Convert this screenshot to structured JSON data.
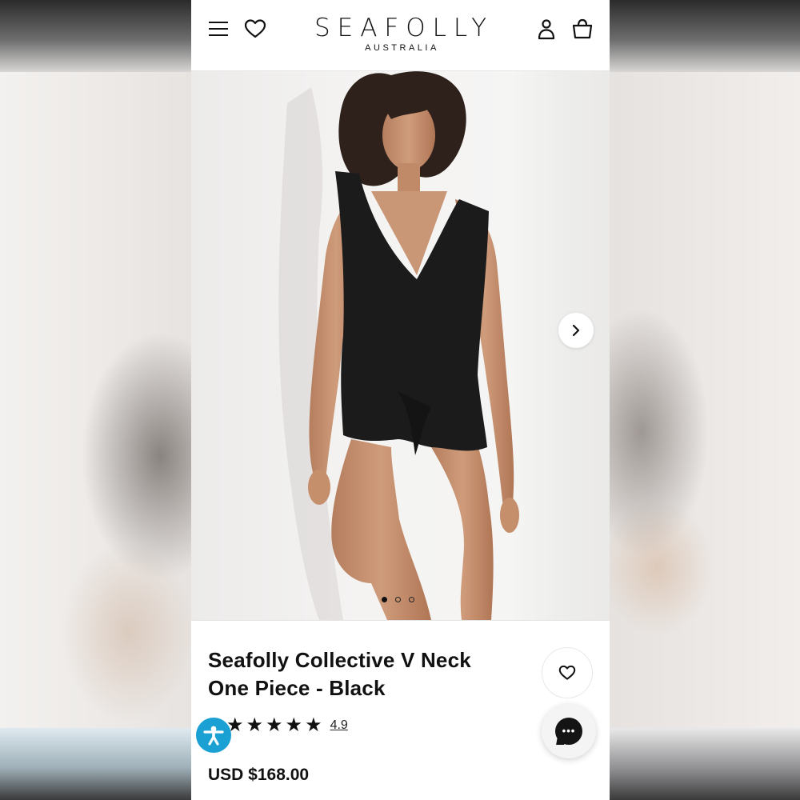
{
  "header": {
    "brand": "SEAFOLLY",
    "brand_sub": "AUSTRALIA",
    "icons": [
      "hamburger-menu-icon",
      "heart-icon",
      "user-icon",
      "shopping-bag-icon"
    ]
  },
  "gallery": {
    "current_slide": 1,
    "total_slides": 3,
    "next_icon": "chevron-right-icon"
  },
  "product": {
    "title": "Seafolly Collective V Neck One Piece - Black",
    "rating": 4.9,
    "rating_label": "4.9",
    "stars_filled": 5,
    "price": "USD $168.00"
  },
  "widgets": {
    "accessibility_icon": "accessibility-icon",
    "chat_icon": "chat-bubble-icon"
  },
  "colors": {
    "accessibility_blue": "#1aa0d3",
    "text": "#111111",
    "swimsuit": "#1a1a1a"
  }
}
